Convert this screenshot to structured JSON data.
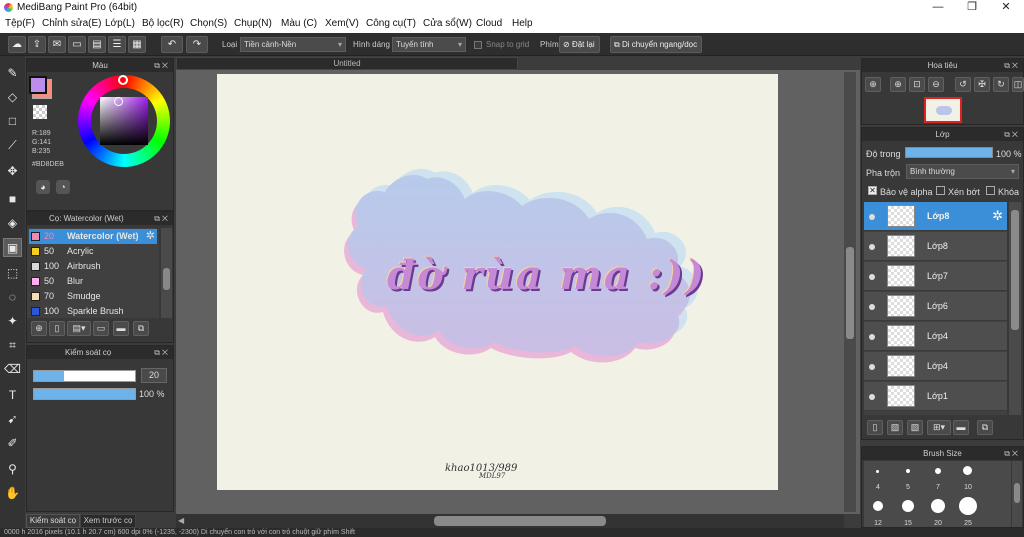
{
  "window": {
    "title": "MediBang Paint Pro (64bit)",
    "minimize": "—",
    "restore": "❐",
    "close": "✕"
  },
  "menu": [
    "Tệp(F)",
    "Chỉnh sửa(E)",
    "Lớp(L)",
    "Bộ lọc(R)",
    "Chọn(S)",
    "Chụp(N)",
    "Màu (C)",
    "Xem(V)",
    "Công cụ(T)",
    "Cửa sổ(W)",
    "Cloud",
    "Help"
  ],
  "toolbar": {
    "loai_label": "Loại",
    "loai_value": "Tiền cảnh-Nền",
    "hinh_dang_label": "Hình dáng",
    "hinh_dang_value": "Tuyến tính",
    "snap_label": "Snap to grid",
    "phim_label": "Phím",
    "dat_lai": "Đặt lại",
    "di_chuyen": "Di chuyển ngang/dọc"
  },
  "color_panel": {
    "title": "Màu",
    "r": "R:189",
    "g": "G:141",
    "b": "B:235",
    "hex": "#BD8DEB",
    "fg_color": "#BD8DEB",
    "bg_color": "#F39080"
  },
  "brush_panel": {
    "title": "Cọ: Watercolor (Wet)",
    "brushes": [
      {
        "size": "20",
        "name": "Watercolor (Wet)",
        "color": "#f08ab0"
      },
      {
        "size": "50",
        "name": "Acrylic",
        "color": "#f5d020"
      },
      {
        "size": "100",
        "name": "Airbrush",
        "color": "#d8d8d8"
      },
      {
        "size": "50",
        "name": "Blur",
        "color": "#ffb0f0"
      },
      {
        "size": "70",
        "name": "Smudge",
        "color": "#f5deb3"
      },
      {
        "size": "100",
        "name": "Sparkle Brush",
        "color": "#2a57d8"
      }
    ]
  },
  "brush_control": {
    "title": "Kiểm soát cọ",
    "size_value": "20",
    "size_fill": 0.3,
    "opacity_value": "100 %",
    "opacity_fill": 1.0
  },
  "bottom_tabs": [
    "Kiểm soát cọ",
    "Xem trước cọ"
  ],
  "document": {
    "tab": "Untitled",
    "artwork_text": "đờ rùa ma :))",
    "signature_line1": "khao1013/989",
    "signature_line2": "MDL97"
  },
  "navigator": {
    "title": "Hoa tiêu"
  },
  "layers_panel": {
    "title": "Lớp",
    "opacity_label": "Độ trong",
    "opacity_value": "100 %",
    "blend_label": "Pha trộn",
    "blend_value": "Bình thường",
    "protect_alpha": "Bảo vệ alpha",
    "clipping": "Xén bớt",
    "lock": "Khóa",
    "layers": [
      "Lớp8",
      "Lớp8",
      "Lớp7",
      "Lớp6",
      "Lớp4",
      "Lớp4",
      "Lớp1"
    ]
  },
  "brush_size_panel": {
    "title": "Brush Size",
    "sizes": [
      "4",
      "5",
      "7",
      "10",
      "12",
      "15",
      "20",
      "25"
    ]
  },
  "status": "0000 h 2016 pixels (10.1 h 20.7 cm) 600 dpi 0% (-1235, -2300) Di chuyển con trỏ với con trỏ chuột giữ phím Shift"
}
